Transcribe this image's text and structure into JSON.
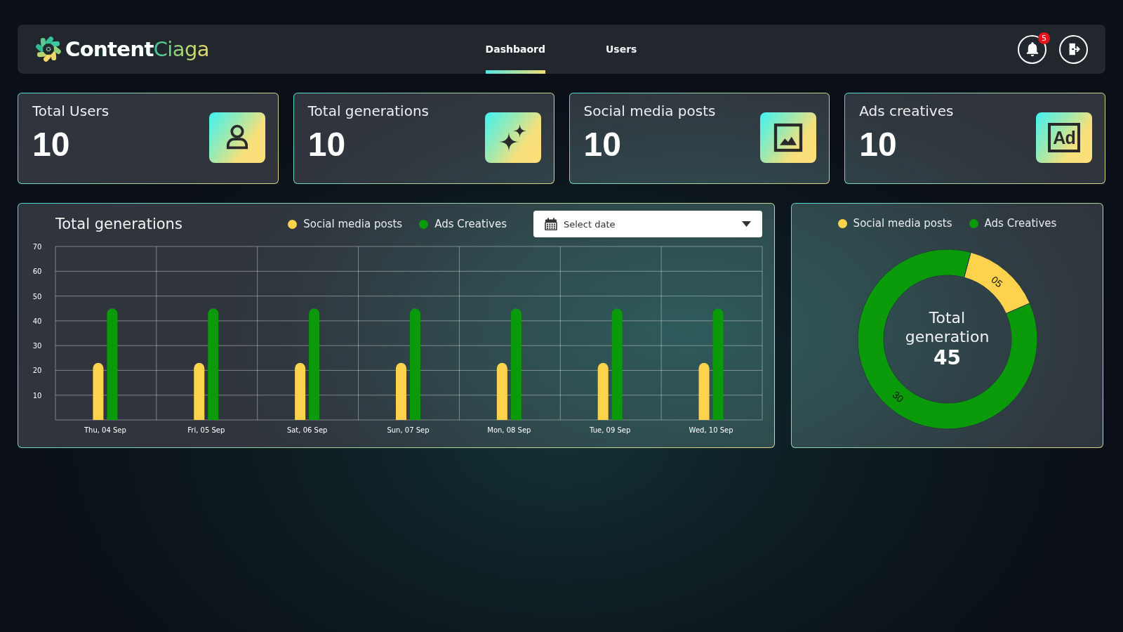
{
  "header": {
    "logo": "**Content**Ciaga",
    "tabs": [
      {
        "label": "Dashbaord",
        "selected": true
      },
      {
        "label": "Users",
        "selected": false
      }
    ],
    "notification_count": "5"
  },
  "stats": [
    {
      "kind": "user",
      "title": "Total Users",
      "value": "10"
    },
    {
      "kind": "sparkles",
      "title": "Total generations",
      "value": "10"
    },
    {
      "kind": "image",
      "title": "Social media posts",
      "value": "10"
    },
    {
      "kind": "ad",
      "title": "Ads creatives",
      "value": "10",
      "icon_text": "Ad"
    }
  ],
  "generations_panel": {
    "date_select": {
      "placeholder": "Select date"
    },
    "chart_data": {
      "type": "bar",
      "title": "Total generations",
      "categories": [
        "Thu, 04 Sep",
        "Fri, 05 Sep",
        "Sat, 06 Sep",
        "Sun, 07 Sep",
        "Mon, 08 Sep",
        "Tue, 09 Sep",
        "Wed, 10 Sep"
      ],
      "series": [
        {
          "name": "Social media posts",
          "color": "#fdd24c",
          "values": [
            23,
            23,
            23,
            23,
            23,
            23,
            23
          ]
        },
        {
          "name": "Ads Creatives",
          "color": "#0a9a0a",
          "values": [
            45,
            45,
            45,
            45,
            45,
            45,
            45
          ]
        }
      ],
      "ylim": [
        0,
        70
      ],
      "yticks": [
        10,
        20,
        30,
        40,
        50,
        60,
        70
      ],
      "grid": true
    }
  },
  "breakdown_panel": {
    "chart_data": {
      "type": "donut",
      "categories": [
        "Social media posts",
        "Ads Creatives"
      ],
      "colors": [
        "#fdd24c",
        "#0a9a0a"
      ],
      "values": [
        5,
        30
      ],
      "data_labels": true,
      "value_labels": [
        "05",
        "30"
      ]
    },
    "center_label": "Total generation",
    "center_value": "45"
  }
}
